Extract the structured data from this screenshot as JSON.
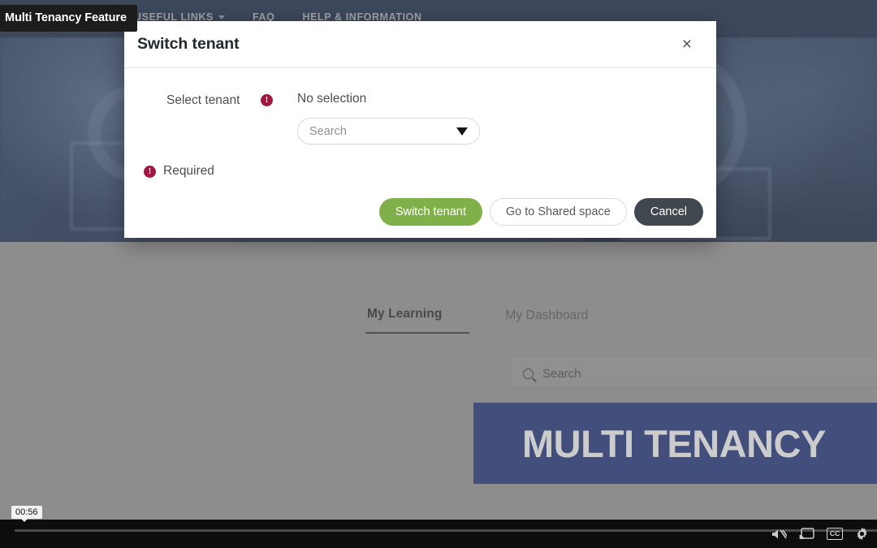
{
  "overlay": {
    "video_title": "Multi Tenancy Feature"
  },
  "topnav": {
    "items": [
      {
        "label": "USEFUL LINKS",
        "has_caret": true
      },
      {
        "label": "FAQ",
        "has_caret": false
      },
      {
        "label": "HELP & INFORMATION",
        "has_caret": false
      }
    ]
  },
  "modal": {
    "title": "Switch tenant",
    "close_label": "×",
    "field": {
      "label": "Select tenant",
      "error_icon_glyph": "!",
      "value_text": "No selection",
      "select_placeholder": "Search",
      "caret_icon": "chevron-down-icon"
    },
    "validation": {
      "icon_glyph": "!",
      "message": "Required"
    },
    "buttons": {
      "primary": "Switch tenant",
      "secondary": "Go to Shared space",
      "cancel": "Cancel"
    },
    "colors": {
      "primary_bg": "#7fb049",
      "cancel_bg": "#41474e",
      "error": "#a31641"
    }
  },
  "page": {
    "tabs": [
      {
        "label": "My Learning",
        "active": true
      },
      {
        "label": "My Dashboard",
        "active": false
      }
    ],
    "search": {
      "placeholder": "Search",
      "icon": "search-icon",
      "value": ""
    },
    "banner": {
      "text": "MULTI TENANCY",
      "bg": "#21357f"
    }
  },
  "video_controls": {
    "current_time_tooltip": "00:56",
    "icons": [
      "mute-icon",
      "cast-icon",
      "closed-captions-icon",
      "settings-gear-icon"
    ],
    "cc_label": "CC"
  }
}
